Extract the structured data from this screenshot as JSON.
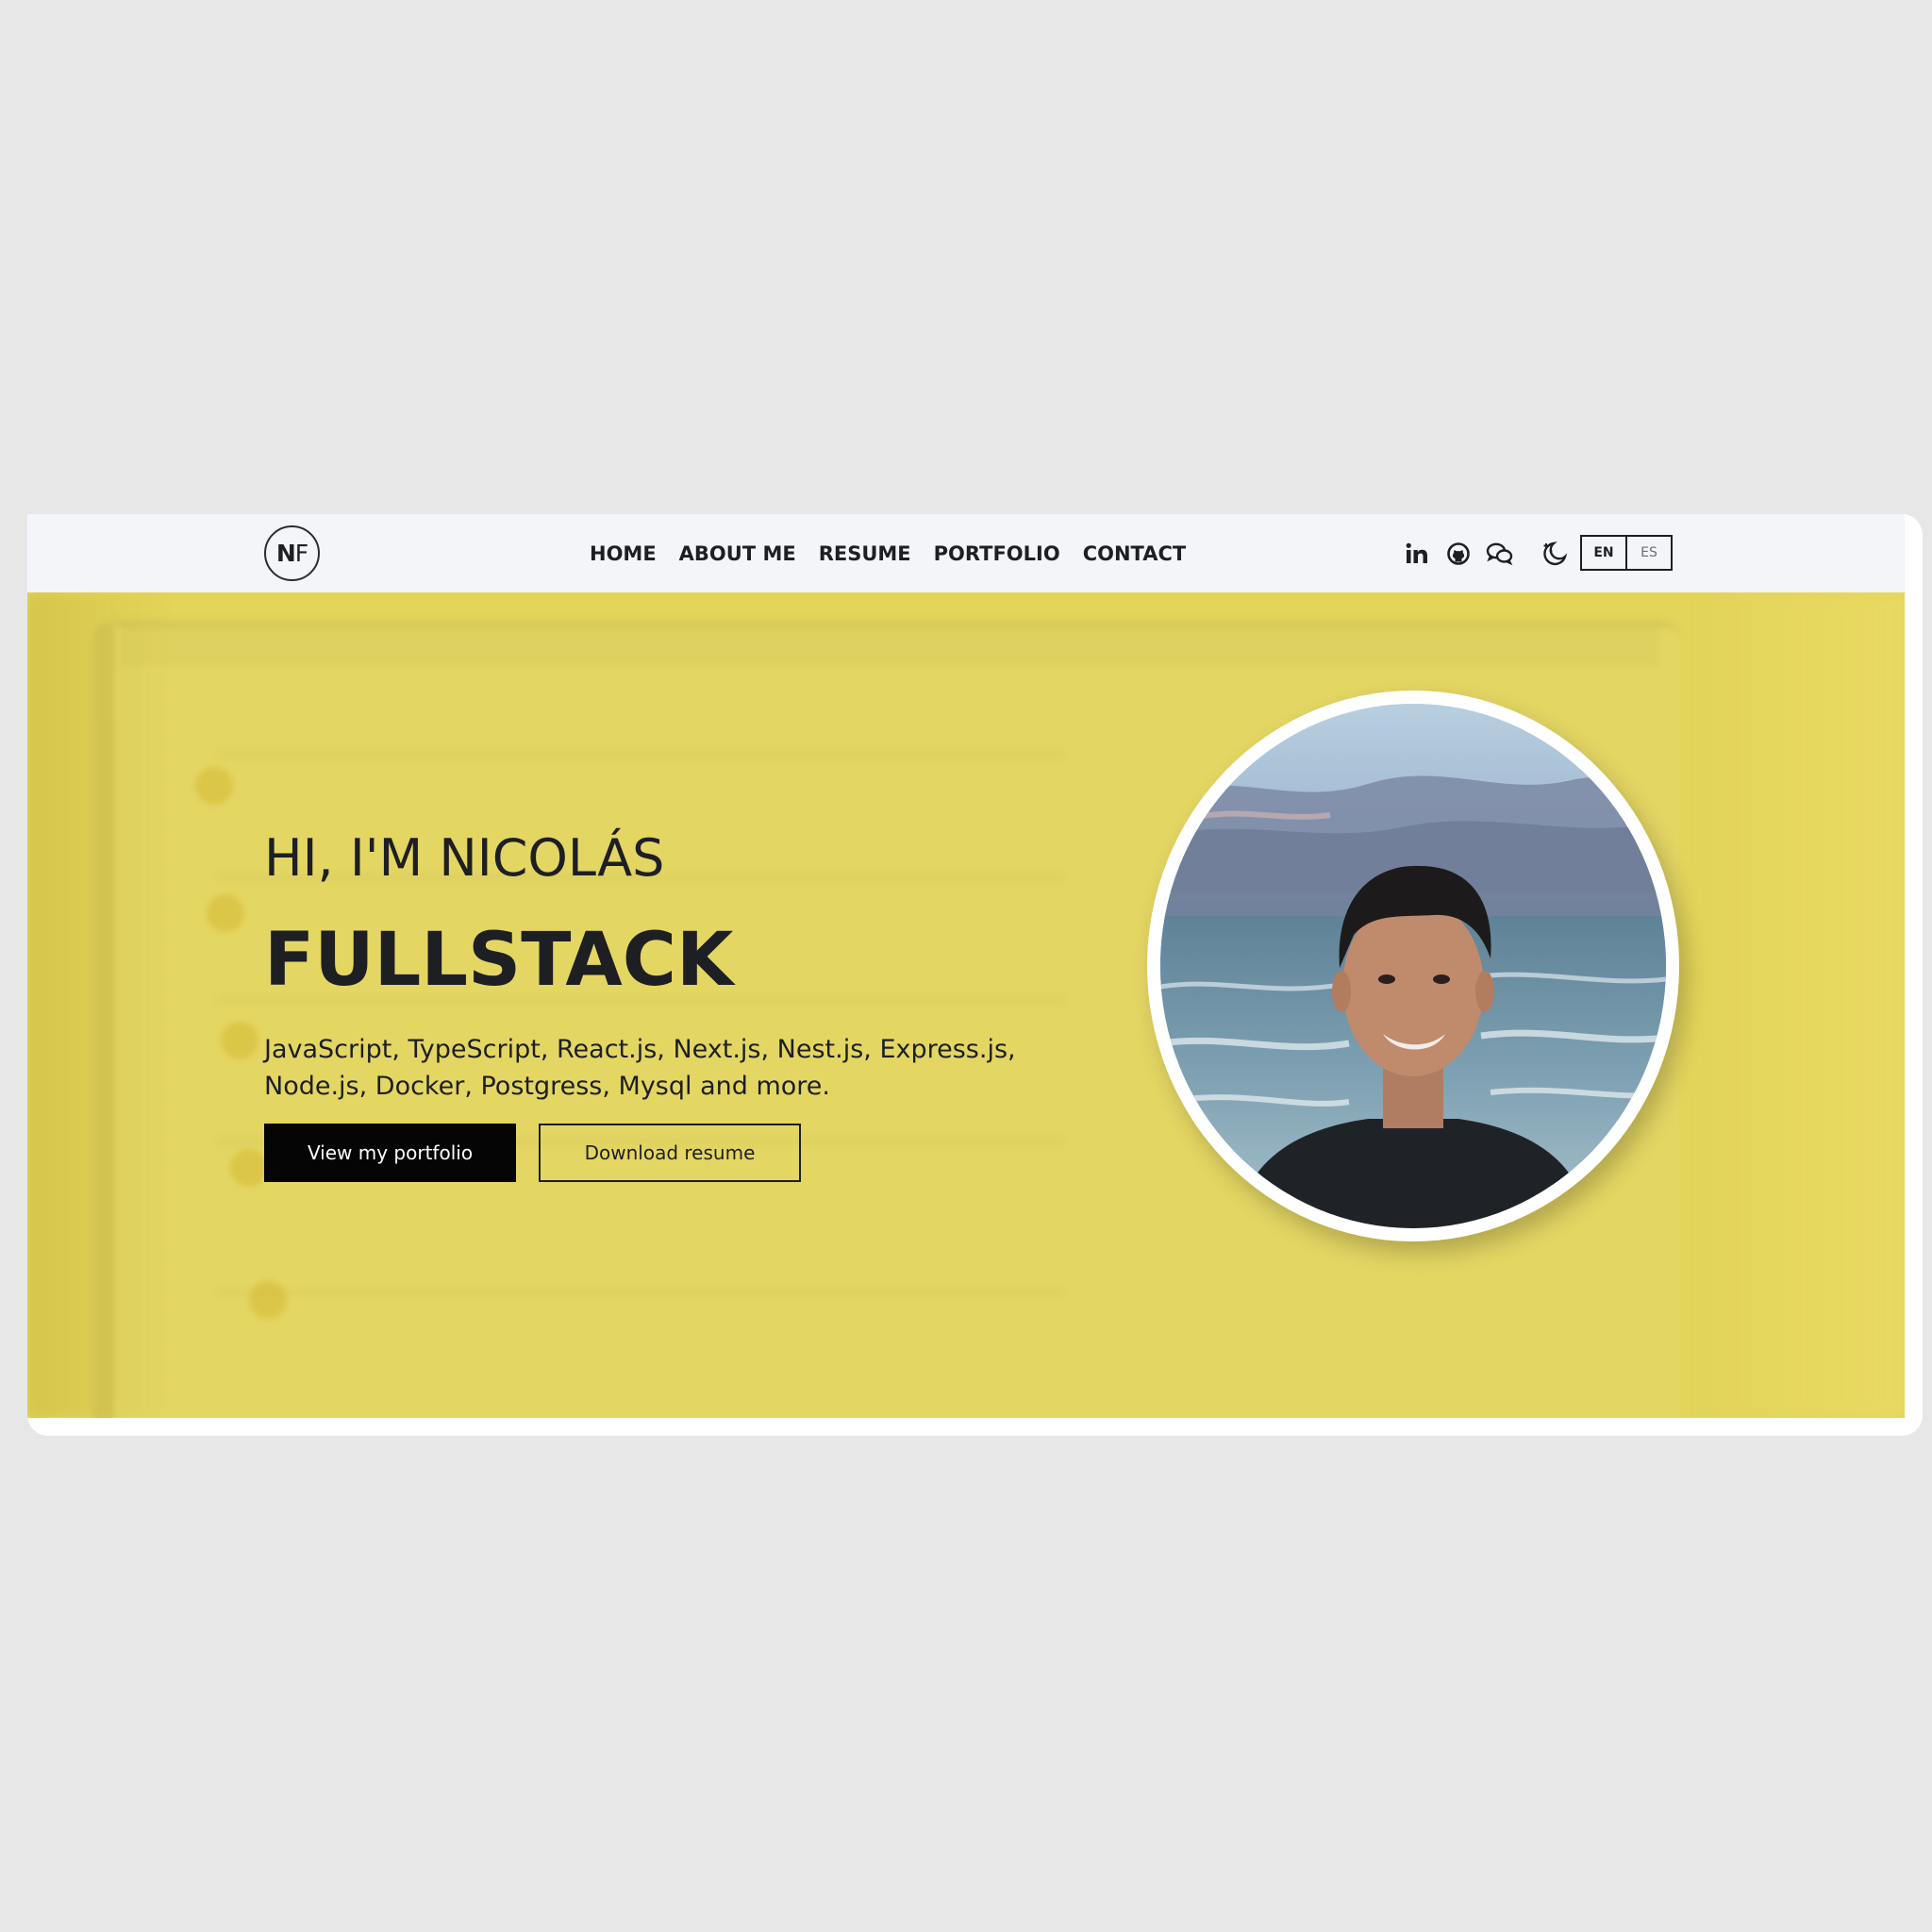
{
  "brand": {
    "logo_first": "N",
    "logo_second": "F"
  },
  "nav": {
    "items": [
      {
        "label": "HOME"
      },
      {
        "label": "ABOUT ME"
      },
      {
        "label": "RESUME"
      },
      {
        "label": "PORTFOLIO"
      },
      {
        "label": "CONTACT"
      }
    ]
  },
  "social": {
    "icons": [
      "linkedin-icon",
      "github-icon",
      "wechat-icon",
      "theme-toggle-icon"
    ]
  },
  "language": {
    "options": [
      {
        "label": "EN",
        "active": true
      },
      {
        "label": "ES",
        "active": false
      }
    ]
  },
  "hero": {
    "greeting": "HI, I'M NICOLÁS",
    "role": "FULLSTACK",
    "skills": "JavaScript, TypeScript, React.js, Next.js, Nest.js, Express.js, Node.js, Docker, Postgress, Mysql and more.",
    "primary_button": "View my portfolio",
    "secondary_button": "Download resume",
    "background_color": "#e3d45a"
  },
  "colors": {
    "page_background": "#e7e7e7",
    "navbar_background": "#f4f5f9",
    "text": "#1d1f23",
    "primary_button": "#050505"
  }
}
